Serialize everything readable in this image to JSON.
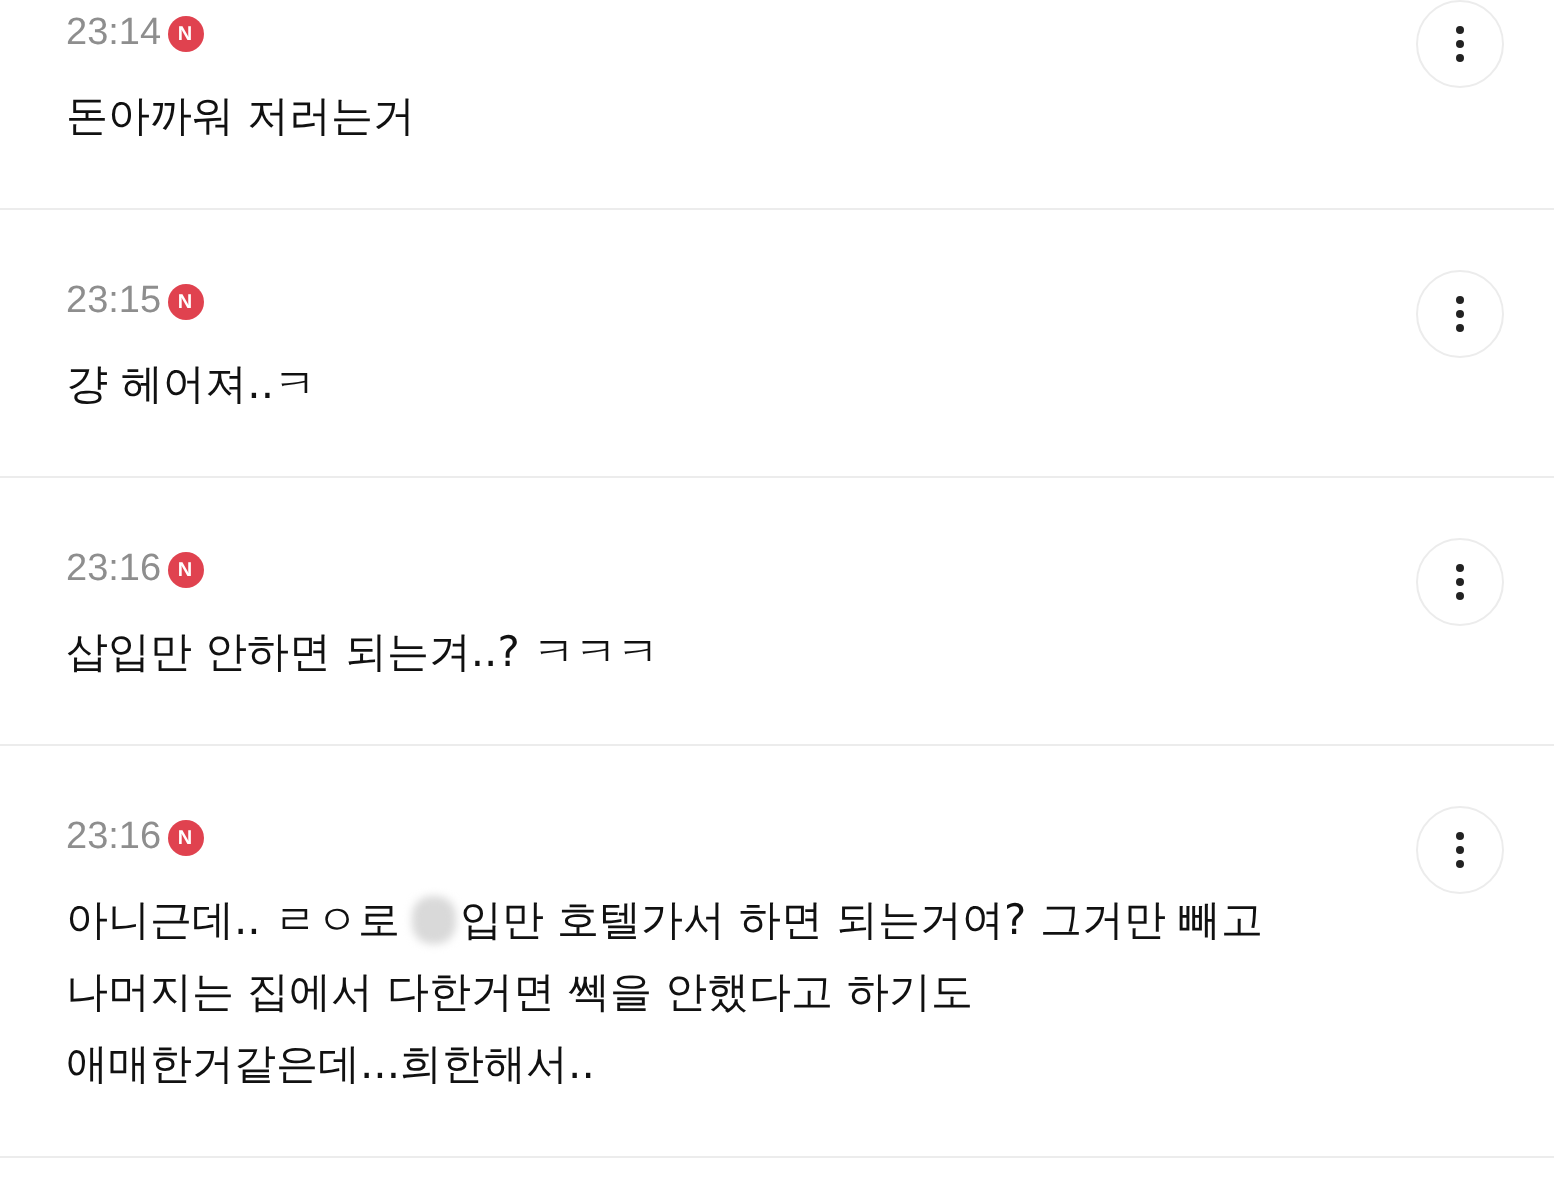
{
  "comments": [
    {
      "time": "23:14",
      "badge": "N",
      "lines": [
        [
          {
            "kind": "text",
            "text": "돈아까워 저러는거"
          }
        ]
      ]
    },
    {
      "time": "23:15",
      "badge": "N",
      "lines": [
        [
          {
            "kind": "text",
            "text": "걍 헤어져..ㅋ"
          }
        ]
      ]
    },
    {
      "time": "23:16",
      "badge": "N",
      "lines": [
        [
          {
            "kind": "text",
            "text": "삽입만 안하면 되는겨..? ㅋㅋㅋ"
          }
        ]
      ]
    },
    {
      "time": "23:16",
      "badge": "N",
      "lines": [
        [
          {
            "kind": "text",
            "text": "아니근데.. ㄹㅇ로"
          },
          {
            "kind": "blur"
          },
          {
            "kind": "text",
            "text": "입만 호텔가서 하면 되는거여? 그거만 빼고"
          }
        ],
        [
          {
            "kind": "text",
            "text": "나머지는 집에서 다한거면 쎅을 안했다고 하기도"
          }
        ],
        [
          {
            "kind": "text",
            "text": "애매한거같은데...희한해서.."
          }
        ]
      ]
    }
  ]
}
